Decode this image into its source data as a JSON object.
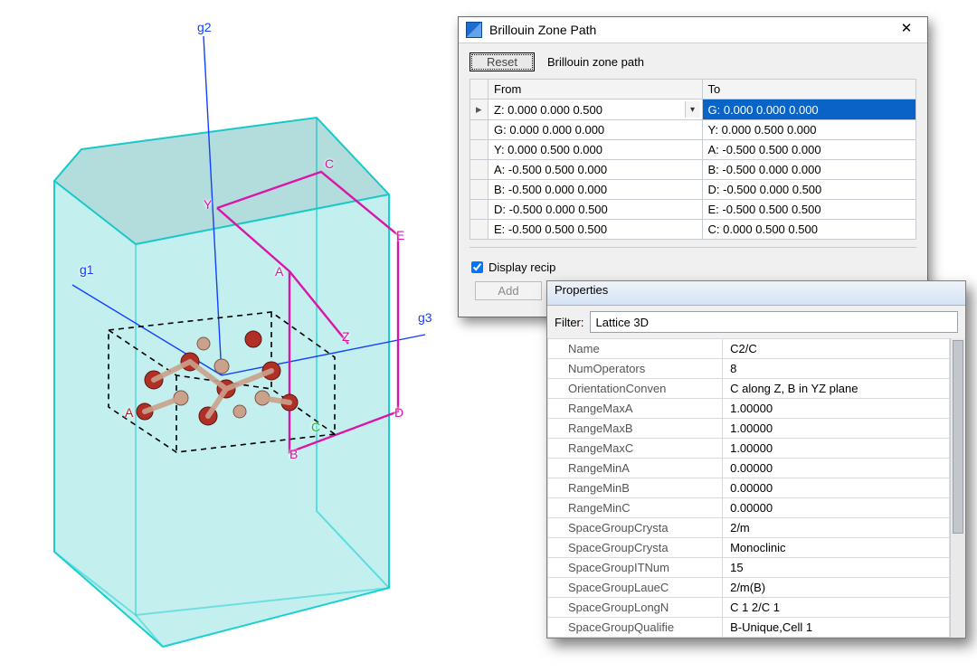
{
  "bz_window": {
    "title": "Brillouin Zone Path",
    "reset_label": "Reset",
    "path_caption": "Brillouin zone path",
    "col_from": "From",
    "col_to": "To",
    "rows": [
      {
        "from": "Z:  0.000  0.000  0.500",
        "to": "G:  0.000  0.000  0.000",
        "sel": true
      },
      {
        "from": "G:  0.000  0.000  0.000",
        "to": "Y:  0.000  0.500  0.000"
      },
      {
        "from": "Y:  0.000  0.500  0.000",
        "to": "A:  -0.500  0.500  0.000"
      },
      {
        "from": "A:  -0.500  0.500  0.000",
        "to": "B:  -0.500  0.000  0.000"
      },
      {
        "from": "B:  -0.500  0.000  0.000",
        "to": "D:  -0.500  0.000  0.500"
      },
      {
        "from": "D:  -0.500  0.000  0.500",
        "to": "E:  -0.500  0.500  0.500"
      },
      {
        "from": "E:  -0.500  0.500  0.500",
        "to": "C:  0.000  0.500  0.500"
      }
    ],
    "display_recip_label": "Display recip",
    "display_recip_checked": true,
    "add_label": "Add"
  },
  "properties": {
    "title": "Properties",
    "filter_label": "Filter:",
    "filter_value": "Lattice 3D",
    "rows": [
      {
        "k": "Name",
        "v": "C2/C"
      },
      {
        "k": "NumOperators",
        "v": "8"
      },
      {
        "k": "OrientationConven",
        "v": "C along Z, B in YZ plane"
      },
      {
        "k": "RangeMaxA",
        "v": "1.00000"
      },
      {
        "k": "RangeMaxB",
        "v": "1.00000"
      },
      {
        "k": "RangeMaxC",
        "v": "1.00000"
      },
      {
        "k": "RangeMinA",
        "v": "0.00000"
      },
      {
        "k": "RangeMinB",
        "v": "0.00000"
      },
      {
        "k": "RangeMinC",
        "v": "0.00000"
      },
      {
        "k": "SpaceGroupCrysta",
        "v": "2/m"
      },
      {
        "k": "SpaceGroupCrysta",
        "v": "Monoclinic"
      },
      {
        "k": "SpaceGroupITNum",
        "v": "15"
      },
      {
        "k": "SpaceGroupLaueC",
        "v": "2/m(B)"
      },
      {
        "k": "SpaceGroupLongN",
        "v": "C 1 2/C 1"
      },
      {
        "k": "SpaceGroupQualifie",
        "v": "B-Unique,Cell 1"
      }
    ]
  },
  "viewport": {
    "axis_g1": "g1",
    "axis_g2": "g2",
    "axis_g3": "g3",
    "labels": {
      "Y": "Y",
      "C": "C",
      "E": "E",
      "A": "A",
      "Z": "Z",
      "B": "B",
      "D": "D",
      "C2": "C",
      "A2": "A"
    }
  }
}
